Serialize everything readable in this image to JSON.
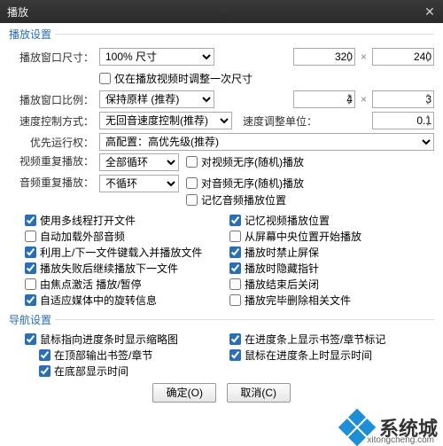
{
  "window": {
    "title": "播放",
    "close_icon": "✕"
  },
  "groups": {
    "playback": "播放设置",
    "nav": "导航设置"
  },
  "labels": {
    "win_size": "播放窗口尺寸：",
    "win_ratio": "播放窗口比例：",
    "speed_ctrl": "速度控制方式：",
    "priority": "优先运行权：",
    "video_repeat": "视频重复播放：",
    "audio_repeat": "音频重复播放：",
    "speed_unit": "速度调整单位：",
    "x": "×"
  },
  "selects": {
    "win_size": "100% 尺寸",
    "win_ratio": "保持原样 (推荐)",
    "speed_ctrl": "无回音速度控制(推荐)",
    "priority": "高配置：高优先级(推荐)",
    "video_repeat": "全部循环",
    "audio_repeat": "不循环"
  },
  "values": {
    "size_w": "320",
    "size_h": "240",
    "ratio_w": "4",
    "ratio_h": "3",
    "speed_step": "0.1"
  },
  "checks": {
    "only_adjust_once": "仅在播放视频时调整一次尺寸",
    "video_random": "对视频无序(随机)播放",
    "audio_random": "对音频无序(随机)播放",
    "remember_audio_pos": "记忆音频播放位置",
    "multithread": "使用多线程打开文件",
    "auto_load_ext_audio": "自动加载外部音频",
    "prev_next_open": "利用上/下一文件键载入并播放文件",
    "fail_next": "播放失败后继续播放下一文件",
    "focus_activate": "由焦点激活 播放/暂停",
    "rotate_info": "自适应媒体中的旋转信息",
    "remember_video_pos": "记忆视频播放位置",
    "start_center": "从屏幕中央位置开始播放",
    "disable_ss": "播放时禁止屏保",
    "hide_cursor": "播放时隐藏指针",
    "close_after": "播放结束后关闭",
    "del_related": "播放完毕删除相关文件",
    "thumb_on_progress": "鼠标指向进度条时显示缩略图",
    "bookmarks_top": "在顶部输出书签/章节",
    "time_bottom": "在底部显示时间",
    "bookmarks_on_bar": "在进度条上显示书签/章节标记",
    "time_on_bar": "鼠标在进度条上时显示时间"
  },
  "check_state": {
    "only_adjust_once": false,
    "video_random": false,
    "audio_random": false,
    "remember_audio_pos": false,
    "multithread": true,
    "auto_load_ext_audio": false,
    "prev_next_open": true,
    "fail_next": true,
    "focus_activate": false,
    "rotate_info": true,
    "remember_video_pos": true,
    "start_center": false,
    "disable_ss": true,
    "hide_cursor": true,
    "close_after": false,
    "del_related": false,
    "thumb_on_progress": true,
    "bookmarks_top": true,
    "time_bottom": true,
    "bookmarks_on_bar": true,
    "time_on_bar": true
  },
  "buttons": {
    "ok": "确定(O)",
    "cancel": "取消(C)"
  },
  "watermark": {
    "brand": "系统城",
    "url": "xitongcheng.com"
  }
}
